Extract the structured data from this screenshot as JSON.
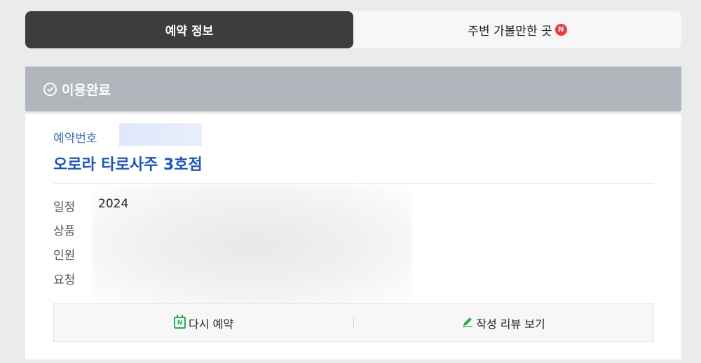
{
  "tabs": [
    {
      "label": "예약 정보",
      "active": true
    },
    {
      "label": "주변 가볼만한 곳",
      "badge": "N",
      "active": false
    }
  ],
  "status": {
    "label": "이용완료"
  },
  "reservation": {
    "number_label": "예약번호",
    "shop_name": "오로라 타로사주 3호점"
  },
  "info": {
    "schedule_label": "일정",
    "schedule_value": "2024",
    "product_label": "상품",
    "people_label": "인원",
    "request_label": "요청"
  },
  "actions": {
    "rebook_label": "다시 예약",
    "review_label": "작성 리뷰 보기"
  },
  "colors": {
    "accent_blue": "#1a54c8",
    "naver_green": "#22b14c",
    "badge_red": "#f2383b",
    "status_gray": "#b1b6bd"
  }
}
